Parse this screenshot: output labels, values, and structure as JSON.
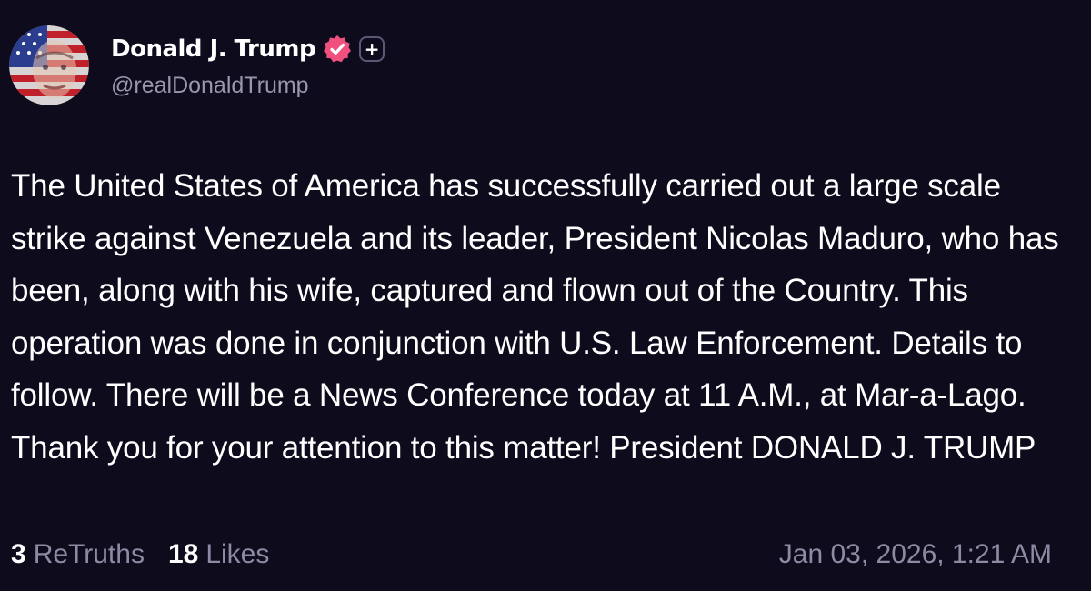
{
  "author": {
    "display_name": "Donald J. Trump",
    "handle": "@realDonaldTrump",
    "verified_icon": "verified-badge-icon",
    "follow_icon": "plus-icon",
    "badge_color": "#f0507e"
  },
  "post": {
    "text": "The United States of America has successfully carried out a large scale strike against Venezuela and its leader, President Nicolas Maduro, who has been, along with his wife, captured and flown out of the Country. This operation was done in conjunction with U.S. Law Enforcement. Details to follow. There will be a News Conference today at 11 A.M., at Mar-a-Lago. Thank you for your attention to this matter! President DONALD J. TRUMP"
  },
  "stats": {
    "retruths_count": "3",
    "retruths_label": "ReTruths",
    "likes_count": "18",
    "likes_label": "Likes",
    "timestamp": "Jan 03, 2026, 1:21 AM"
  },
  "colors": {
    "background": "#0e0b1c",
    "text_primary": "#ffffff",
    "text_muted": "#8d8aa3"
  }
}
